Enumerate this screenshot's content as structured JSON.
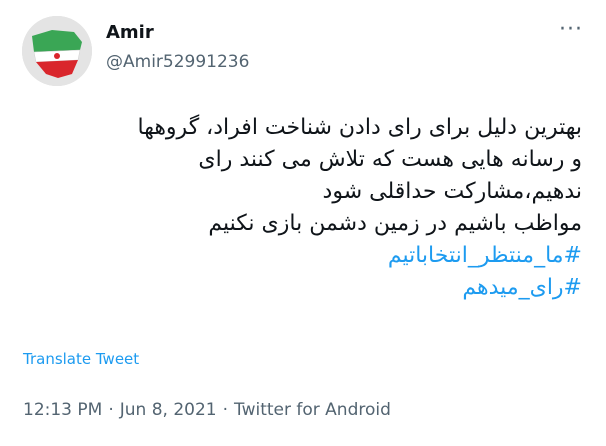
{
  "author": {
    "display_name": "Amir",
    "handle": "@Amir52991236",
    "avatar_icon": "iran-flag-map-avatar"
  },
  "more_icon": "more-options-icon",
  "more_glyph": "···",
  "tweet": {
    "lines": [
      "بهترین دلیل برای رای دادن شناخت افراد، گروهها",
      "و رسانه هایی هست که تلاش می کنند  رای",
      "ندهیم،مشارکت حداقلی شود",
      "مواظب باشیم در زمین دشمن بازی نکنیم"
    ],
    "hashtags": [
      "#ما_منتظر_انتخاباتیم",
      "#رای_میدهم"
    ]
  },
  "translate_label": "Translate Tweet",
  "meta": {
    "time": "12:13 PM",
    "separator": "·",
    "date": "Jun 8, 2021",
    "source": "Twitter for Android"
  },
  "colors": {
    "link": "#1d9bf0",
    "secondary_text": "#536471",
    "primary_text": "#0f1419"
  }
}
